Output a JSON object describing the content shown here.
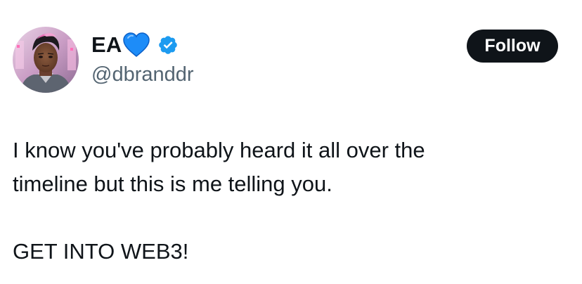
{
  "author": {
    "display_name": "EA",
    "handle": "@dbranddr",
    "name_emoji_icon": "blue-heart-icon",
    "badge_icon": "verified-badge-icon",
    "badge_color": "#1d9bf0",
    "avatar_icon": "avatar-image"
  },
  "actions": {
    "follow_label": "Follow"
  },
  "tweet": {
    "lines": [
      "I know you've probably heard it all over the",
      "timeline but this is me telling you.",
      "GET INTO WEB3!"
    ]
  },
  "colors": {
    "text": "#0f1419",
    "secondary_text": "#536471",
    "button_bg": "#0f1419",
    "button_text": "#ffffff",
    "heart": "#1d8cf8"
  }
}
